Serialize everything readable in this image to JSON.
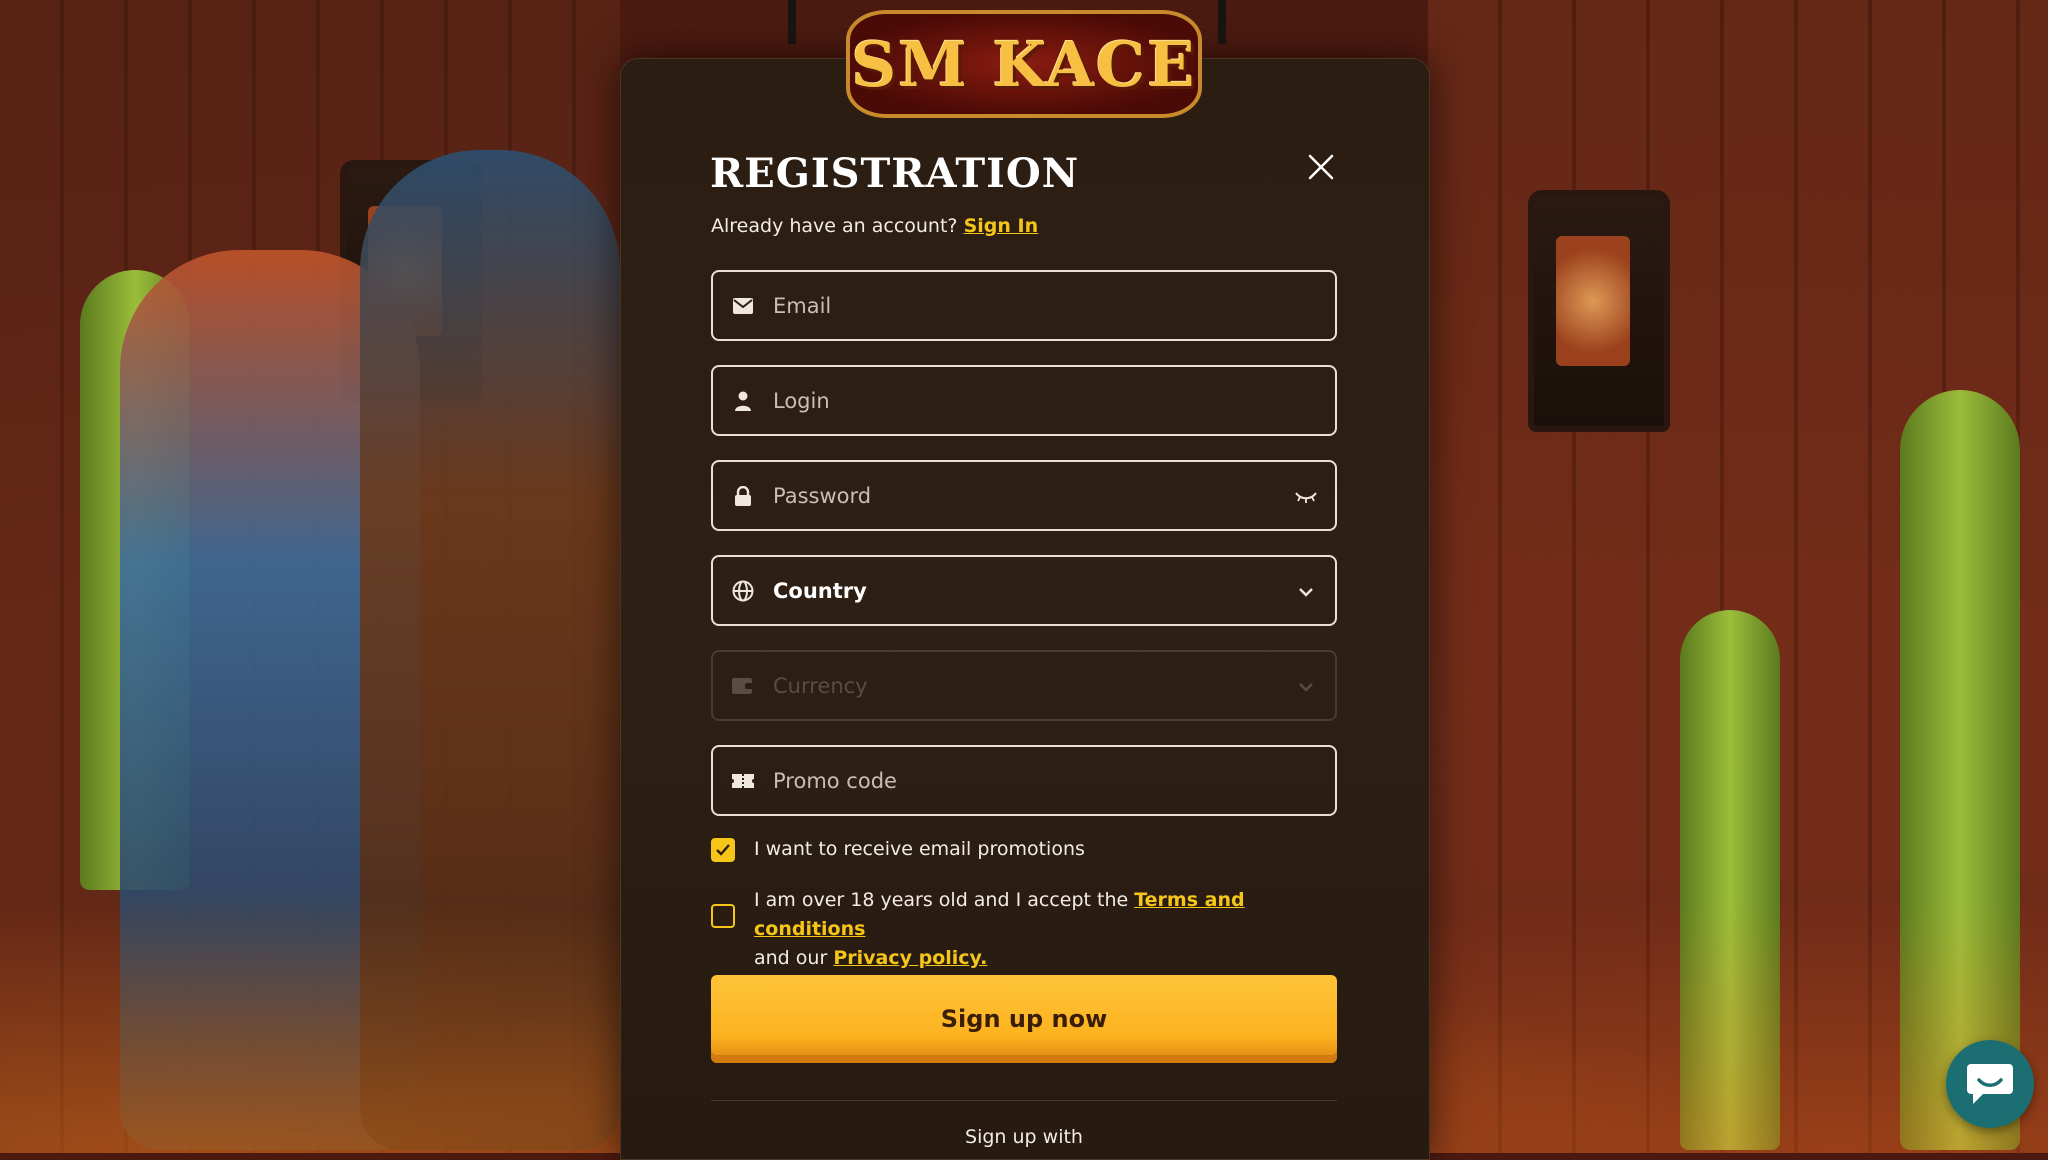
{
  "brand": {
    "logo_text": "SM KACE"
  },
  "modal": {
    "title": "REGISTRATION",
    "subtitle": "Already have an account?",
    "sign_in_link": "Sign In"
  },
  "fields": {
    "email": {
      "placeholder": "Email",
      "icon": "envelope-icon"
    },
    "login": {
      "placeholder": "Login",
      "icon": "user-icon"
    },
    "password": {
      "placeholder": "Password",
      "icon": "lock-icon",
      "toggle_icon": "eye-closed-icon"
    },
    "country": {
      "value": "Country",
      "icon": "globe-icon",
      "dropdown_icon": "chevron-down-icon"
    },
    "currency": {
      "placeholder": "Currency",
      "icon": "wallet-icon",
      "dropdown_icon": "chevron-down-icon",
      "disabled": true
    },
    "promo": {
      "placeholder": "Promo code",
      "icon": "ticket-icon"
    }
  },
  "checkboxes": {
    "promotions": {
      "checked": true,
      "label": "I want to receive email promotions"
    },
    "terms": {
      "checked": false,
      "text_before": "I am over 18 years old and I accept the",
      "terms_link": "Terms and conditions",
      "text_middle": "and our",
      "privacy_link": "Privacy policy."
    }
  },
  "actions": {
    "signup_button": "Sign up now",
    "signup_with": "Sign up with"
  },
  "colors": {
    "accent": "#f5c518",
    "button": "#fcb21f",
    "modal_bg": "#2b1d12",
    "chat": "#1b6f73"
  }
}
